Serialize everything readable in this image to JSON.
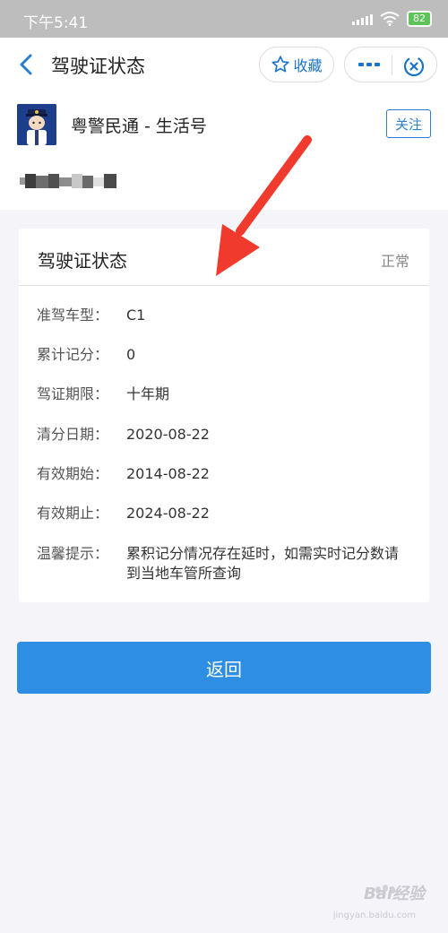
{
  "status_bar": {
    "time": "下午5:41",
    "battery": "82"
  },
  "nav": {
    "title": "驾驶证状态",
    "favorite_label": "收藏"
  },
  "account": {
    "name": "粤警民通 - 生活号",
    "follow_label": "关注"
  },
  "card": {
    "title": "驾驶证状态",
    "status": "正常",
    "rows": [
      {
        "label": "准驾车型：",
        "value": "C1"
      },
      {
        "label": "累计记分：",
        "value": "0"
      },
      {
        "label": "驾证期限：",
        "value": "十年期"
      },
      {
        "label": "清分日期：",
        "value": "2020-08-22"
      },
      {
        "label": "有效期始：",
        "value": "2014-08-22"
      },
      {
        "label": "有效期止：",
        "value": "2024-08-22"
      },
      {
        "label": "温馨提示：",
        "value": "累积记分情况存在延时，如需实时记分数请到当地车管所查询"
      }
    ]
  },
  "return_label": "返回",
  "watermark": {
    "text": "Bai经验",
    "sub": "jingyan.baidu.com"
  },
  "colors": {
    "accent": "#2d8ee3",
    "link": "#1a73c8",
    "arrow": "#f03a2e"
  }
}
